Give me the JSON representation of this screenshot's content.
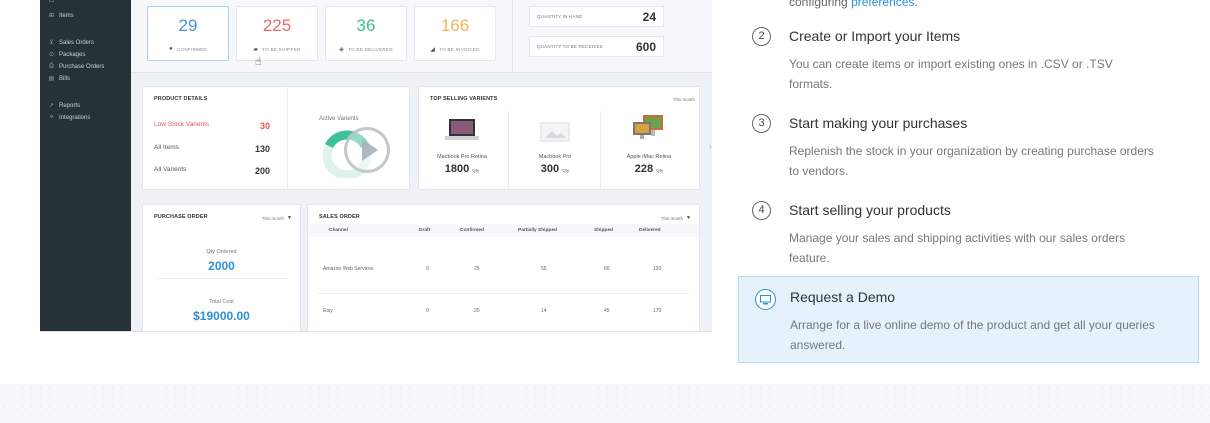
{
  "sidebar": {
    "items": [
      {
        "icon": "⊞",
        "label": "Items"
      },
      {
        "icon": "⊻",
        "label": "Sales Orders"
      },
      {
        "icon": "⊙",
        "label": "Packages"
      },
      {
        "icon": "⎙",
        "label": "Purchase Orders"
      },
      {
        "icon": "▤",
        "label": "Bills"
      },
      {
        "icon": "↗",
        "label": "Reports"
      },
      {
        "icon": "⟡",
        "label": "Integrations"
      }
    ]
  },
  "activity": [
    {
      "value": "29",
      "label": "CONFIRMED",
      "color": "#4a90d9"
    },
    {
      "value": "225",
      "label": "TO BE SHIPPED",
      "color": "#e86a6a"
    },
    {
      "value": "36",
      "label": "TO BE DELIVERED",
      "color": "#3fbf9a"
    },
    {
      "value": "166",
      "label": "TO BE INVOICED",
      "color": "#f0b35a"
    }
  ],
  "inventory": {
    "in_hand_label": "QUANTITY IN HAND",
    "in_hand_value": "24",
    "to_receive_label": "QUANTITY TO BE RECEIVED",
    "to_receive_value": "600"
  },
  "product_details": {
    "title": "PRODUCT DETAILS",
    "rows": [
      {
        "label": "Low Stock Varients",
        "value": "30"
      },
      {
        "label": "All Items",
        "value": "130"
      },
      {
        "label": "All Varients",
        "value": "200"
      }
    ],
    "active_label": "Active Varients",
    "active_value": "45"
  },
  "top_selling": {
    "title": "TOP SELLING VARIENTS",
    "filter": "This month",
    "products": [
      {
        "name": "Macbook Pro Retina",
        "qty": "1800",
        "unit": "Qty"
      },
      {
        "name": "Macbook Pro",
        "qty": "300",
        "unit": "Qty"
      },
      {
        "name": "Apple iMac Retina",
        "qty": "228",
        "unit": "Qty"
      }
    ]
  },
  "purchase_order": {
    "title": "PURCHASE ORDER",
    "filter": "This month",
    "qty_label": "Qty Ordered",
    "qty_value": "2000",
    "cost_label": "Total Cost",
    "cost_value": "$19000.00"
  },
  "sales_order": {
    "title": "SALES ORDER",
    "filter": "This month",
    "headers": [
      "Channel",
      "Draft",
      "Confirmed",
      "Partially Shipped",
      "Shipped",
      "Delivered"
    ],
    "rows": [
      [
        "Amazon Web Services",
        "0",
        "25",
        "55",
        "60",
        "120"
      ],
      [
        "Etsy",
        "0",
        "20",
        "14",
        "45",
        "170"
      ]
    ]
  },
  "steps": {
    "partial_text": "configuring",
    "partial_link": "preferences.",
    "list": [
      {
        "num": "2",
        "title": "Create or Import your Items",
        "desc": "You can create items or import existing ones in .CSV or .TSV formats."
      },
      {
        "num": "3",
        "title": "Start making your purchases",
        "desc": "Replenish the stock in your organization by creating purchase orders to vendors."
      },
      {
        "num": "4",
        "title": "Start selling your products",
        "desc": "Manage your sales and shipping activities with our sales orders feature."
      }
    ]
  },
  "demo": {
    "title": "Request a Demo",
    "desc": "Arrange for a live online demo of the product and get all your queries answered."
  }
}
